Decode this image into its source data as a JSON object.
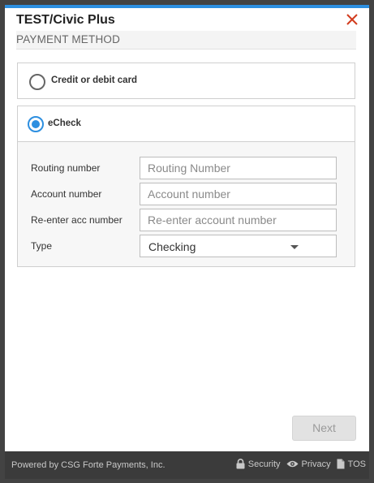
{
  "dialog": {
    "title": "TEST/Civic Plus",
    "section_header": "PAYMENT METHOD",
    "close_icon": "close-icon",
    "accent_color": "#2d8fe0"
  },
  "payment_options": {
    "card_label": "Credit or debit card",
    "echeck_label": "eCheck",
    "selected": "eCheck"
  },
  "echeck_form": {
    "routing": {
      "label": "Routing number",
      "placeholder": "Routing Number",
      "value": ""
    },
    "account": {
      "label": "Account number",
      "placeholder": "Account number",
      "value": ""
    },
    "reenter": {
      "label": "Re-enter acc number",
      "placeholder": "Re-enter account number",
      "value": ""
    },
    "type": {
      "label": "Type",
      "value": "Checking"
    }
  },
  "actions": {
    "next_label": "Next"
  },
  "footer": {
    "powered_by": "Powered by CSG Forte Payments, Inc.",
    "security_label": "Security",
    "privacy_label": "Privacy",
    "tos_label": "TOS"
  }
}
